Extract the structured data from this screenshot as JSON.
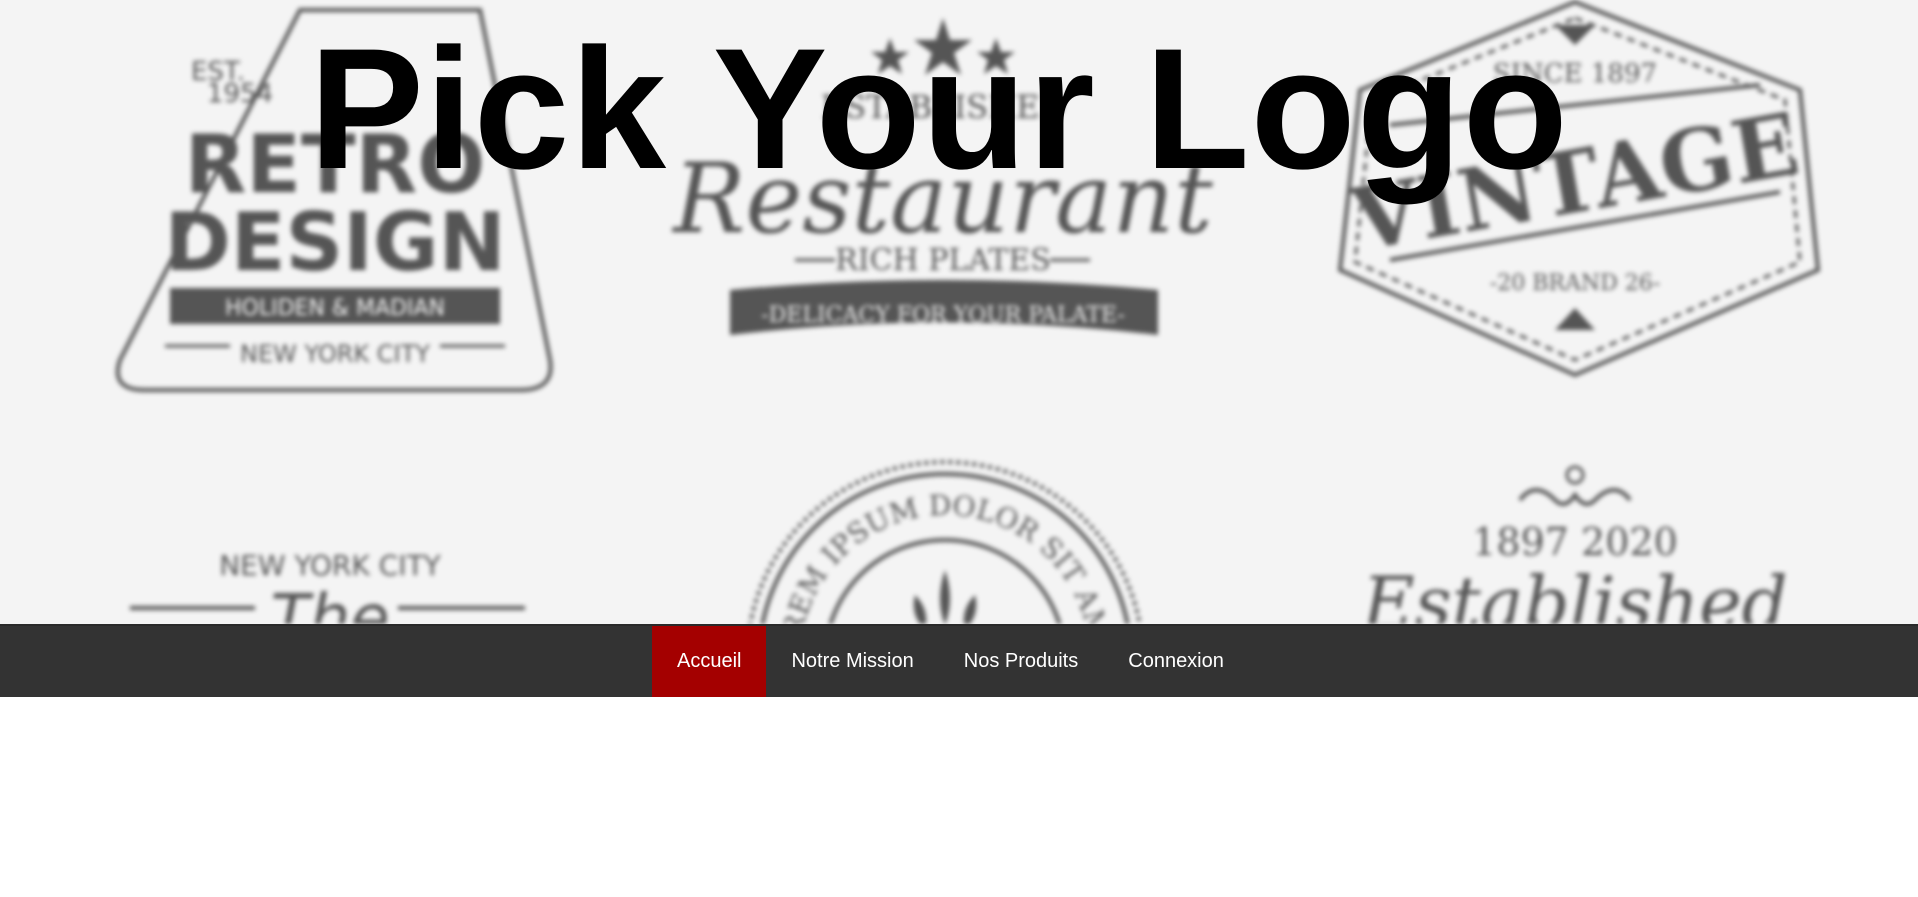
{
  "hero": {
    "title": "Pick Your Logo",
    "background_logos": {
      "retro": {
        "est": "EST.",
        "year": "1954",
        "line1": "RETRO",
        "line2": "DESIGN",
        "banner": "HOLIDEN & MADIAN",
        "city": "NEW YORK CITY"
      },
      "restaurant": {
        "top": "ESTABLISHED",
        "script": "Restaurant",
        "sub": "RICH PLATES",
        "ribbon": "-DELICACY FOR YOUR PALATE-"
      },
      "vintage": {
        "since": "SINCE 1897",
        "word": "VINTAGE",
        "brand": "-20 BRAND 26-"
      },
      "newyork": {
        "city": "NEW YORK CITY",
        "script": "The"
      },
      "seal": {
        "arc": "LOREM IPSUM DOLOR SIT AMET"
      },
      "established": {
        "years": "1897   2020",
        "script": "Established"
      }
    }
  },
  "nav": {
    "items": [
      {
        "label": "Accueil",
        "active": true
      },
      {
        "label": "Notre Mission",
        "active": false
      },
      {
        "label": "Nos Produits",
        "active": false
      },
      {
        "label": "Connexion",
        "active": false
      }
    ]
  },
  "colors": {
    "nav_bg": "#333333",
    "nav_active": "#a40000",
    "hero_bg": "#f4f4f4",
    "logo_ink": "#555555"
  }
}
